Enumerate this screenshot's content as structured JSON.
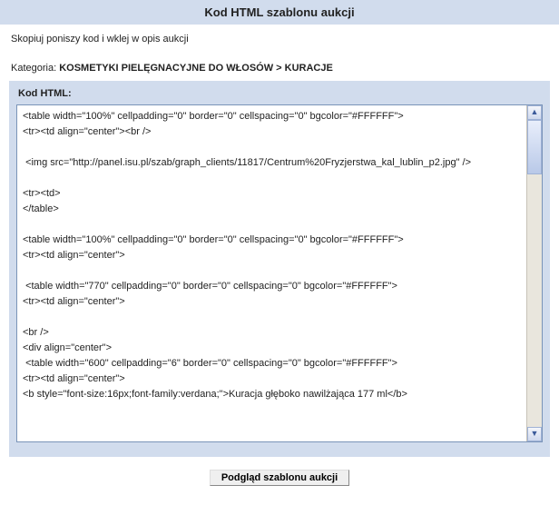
{
  "title": "Kod HTML szablonu aukcji",
  "instruction": "Skopiuj poniszy kod i wklej w opis aukcji",
  "category_label": "Kategoria:",
  "category_path": "KOSMETYKI PIELĘGNACYJNE DO WŁOSÓW > KURACJE",
  "panel_label": "Kod HTML:",
  "code": "<table width=\"100%\" cellpadding=\"0\" border=\"0\" cellspacing=\"0\" bgcolor=\"#FFFFFF\">\n<tr><td align=\"center\"><br />\n\n <img src=\"http://panel.isu.pl/szab/graph_clients/11817/Centrum%20Fryzjerstwa_kal_lublin_p2.jpg\" />\n\n<tr><td>\n</table>\n\n<table width=\"100%\" cellpadding=\"0\" border=\"0\" cellspacing=\"0\" bgcolor=\"#FFFFFF\">\n<tr><td align=\"center\">\n\n <table width=\"770\" cellpadding=\"0\" border=\"0\" cellspacing=\"0\" bgcolor=\"#FFFFFF\">\n<tr><td align=\"center\">\n\n<br />\n<div align=\"center\">\n <table width=\"600\" cellpadding=\"6\" border=\"0\" cellspacing=\"0\" bgcolor=\"#FFFFFF\">\n<tr><td align=\"center\">\n<b style=\"font-size:16px;font-family:verdana;\">Kuracja głęboko nawilżająca 177 ml</b>",
  "preview_button": "Podgląd szablonu aukcji"
}
